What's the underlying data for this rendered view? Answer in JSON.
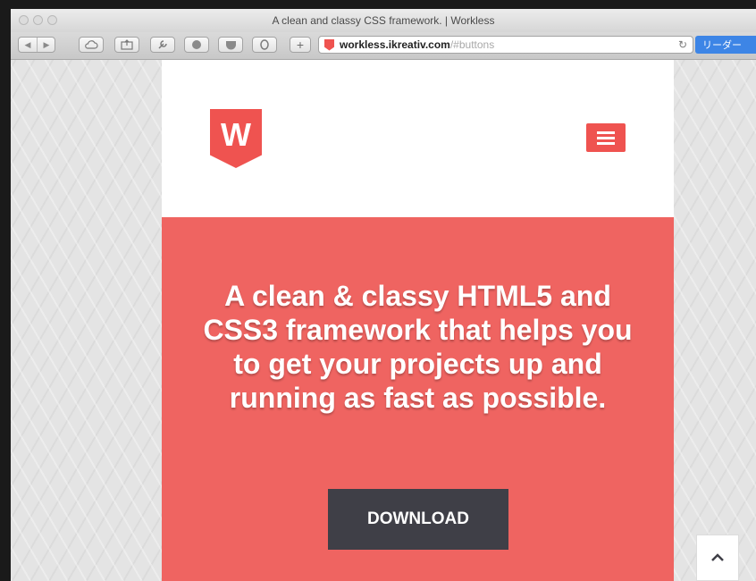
{
  "window": {
    "title": "A clean and classy CSS framework. | Workless"
  },
  "toolbar": {
    "url_host": "workless.ikreativ.com",
    "url_path": "/#buttons",
    "reader_label": "リーダー"
  },
  "site": {
    "logo_letter": "W",
    "hero_headline": "A clean & classy HTML5 and CSS3 framework that helps you to get your projects up and running as fast as possible.",
    "download_label": "DOWNLOAD"
  },
  "colors": {
    "brand": "#ef6461",
    "button_dark": "#3f3f47"
  }
}
